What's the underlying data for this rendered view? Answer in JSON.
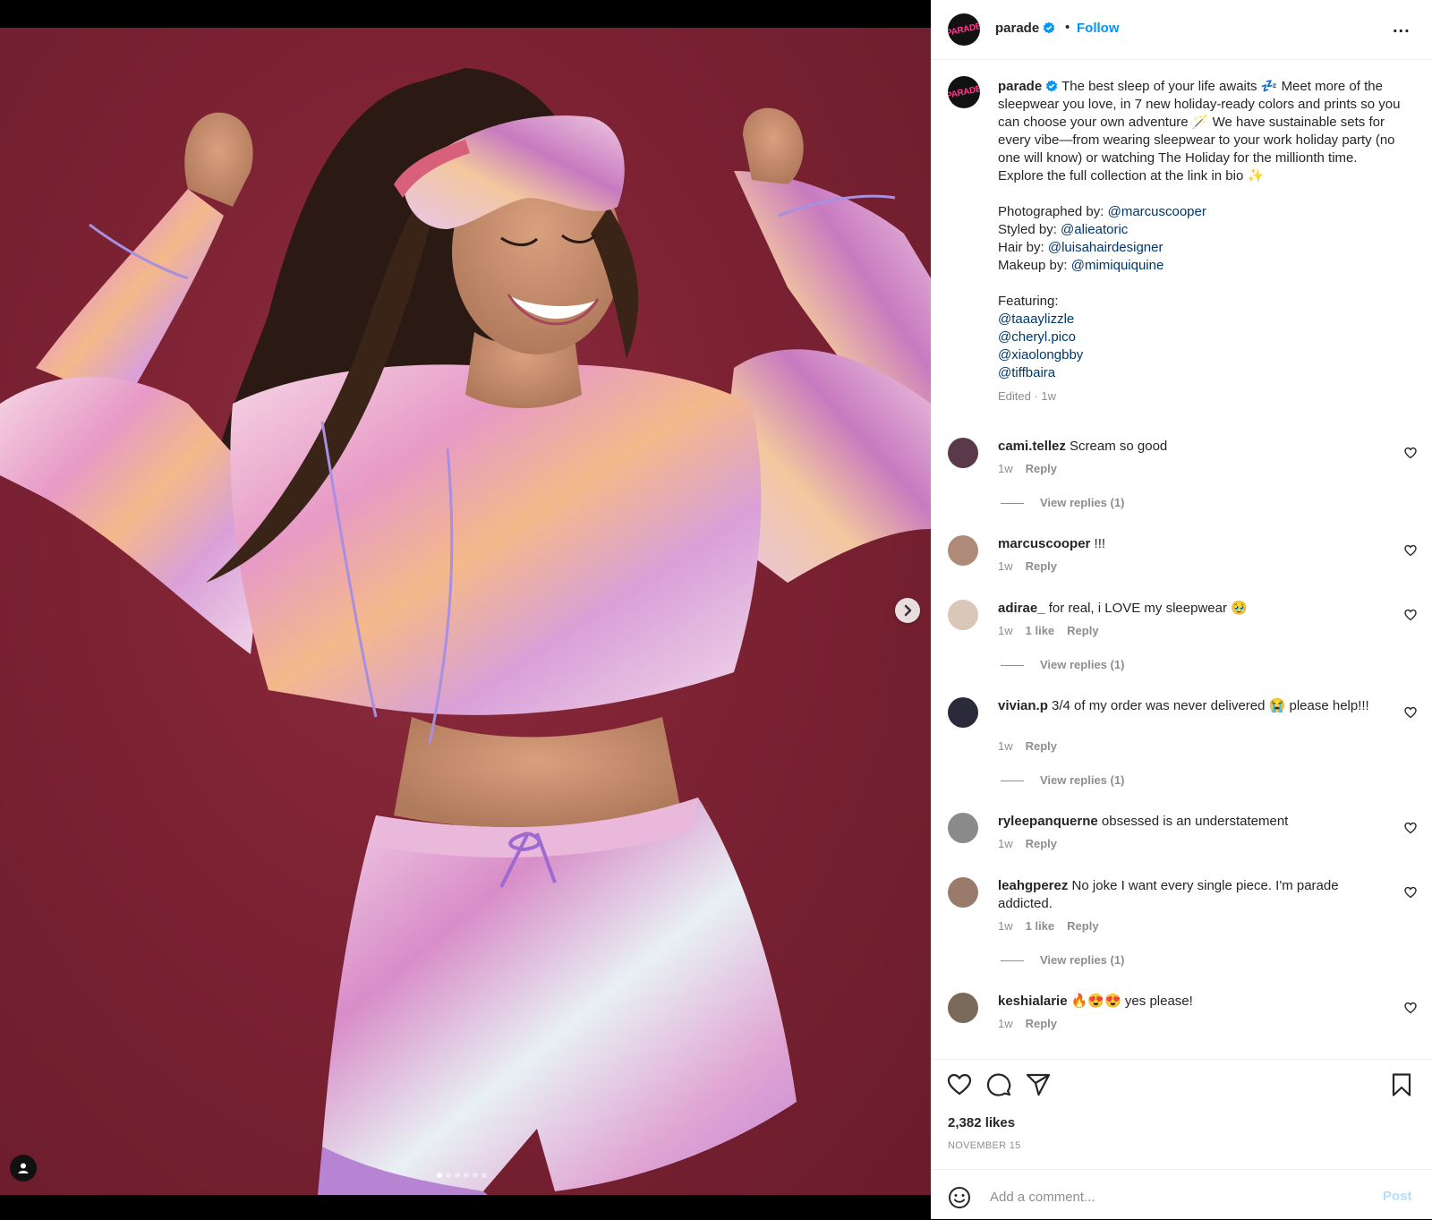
{
  "post": {
    "username": "parade",
    "follow_label": "Follow",
    "separator": "•",
    "more_label": "...",
    "avatar_text": "PARADE",
    "carousel": {
      "total": 6,
      "current": 1
    }
  },
  "caption": {
    "username": "parade",
    "text_1": "The best sleep of your life awaits 💤 Meet more of the sleepwear you love, in 7 new holiday-ready colors and prints so you can choose your own adventure 🪄 We have sustainable sets for every vibe—from wearing sleepwear to your work holiday party (no one will know) or watching The Holiday for the millionth time. Explore the full collection at the link in bio ✨",
    "credits": [
      {
        "label": "Photographed by: ",
        "handle": "@marcuscooper"
      },
      {
        "label": "Styled by: ",
        "handle": "@alieatoric"
      },
      {
        "label": "Hair by: ",
        "handle": "@luisahairdesigner"
      },
      {
        "label": "Makeup by: ",
        "handle": "@mimiquiquine"
      }
    ],
    "featuring_label": "Featuring:",
    "featuring": [
      "@taaaylizzle",
      "@cheryl.pico",
      "@xiaolongbby",
      "@tiffbaira"
    ],
    "edited": "Edited · 1w"
  },
  "comments": [
    {
      "user": "cami.tellez",
      "text": "Scream so good",
      "time": "1w",
      "likes": "",
      "reply": "Reply",
      "replies": "View replies (1)",
      "avatar_color": "#5a3a4a"
    },
    {
      "user": "marcuscooper",
      "text": "!!!",
      "time": "1w",
      "likes": "",
      "reply": "Reply",
      "replies": "",
      "avatar_color": "#b08a78"
    },
    {
      "user": "adirae_",
      "text": "for real, i LOVE my sleepwear 🥹",
      "time": "1w",
      "likes": "1 like",
      "reply": "Reply",
      "replies": "View replies (1)",
      "avatar_color": "#d9c7b8"
    },
    {
      "user": "vivian.p",
      "text": "3/4 of my order was never delivered 😭 please help!!!",
      "time": "1w",
      "likes": "",
      "reply": "Reply",
      "replies": "View replies (1)",
      "avatar_color": "#2a2a3a"
    },
    {
      "user": "ryleepanquerne",
      "text": "obsessed is an understatement",
      "time": "1w",
      "likes": "",
      "reply": "Reply",
      "replies": "",
      "avatar_color": "#8a8a8a"
    },
    {
      "user": "leahgperez",
      "text": "No joke I want every single piece. I'm parade addicted.",
      "time": "1w",
      "likes": "1 like",
      "reply": "Reply",
      "replies": "View replies (1)",
      "avatar_color": "#9a7a6a"
    },
    {
      "user": "keshialarie",
      "text": "🔥😍😍 yes please!",
      "time": "1w",
      "likes": "",
      "reply": "Reply",
      "replies": "",
      "avatar_color": "#7a6a5a"
    }
  ],
  "footer": {
    "likes": "2,382 likes",
    "date": "NOVEMBER 15",
    "comment_placeholder": "Add a comment...",
    "post_label": "Post"
  },
  "colors": {
    "link": "#00376b",
    "follow": "#0095f6",
    "muted": "#8e8e8e",
    "background": "#7c2233"
  },
  "icons": [
    "heart-icon",
    "comment-icon",
    "share-icon",
    "bookmark-icon",
    "emoji-icon",
    "chevron-right-icon",
    "user-tag-icon",
    "more-icon",
    "verified-icon"
  ]
}
